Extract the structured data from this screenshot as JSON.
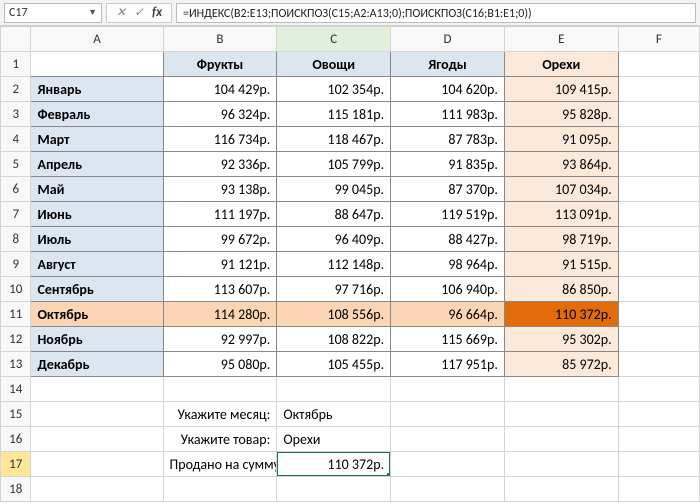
{
  "formula_bar": {
    "cell_ref": "C17",
    "formula": "=ИНДЕКС(B2:E13;ПОИСКПОЗ(C15;A2:A13;0);ПОИСКПОЗ(C16;B1:E1;0))"
  },
  "columns": [
    "A",
    "B",
    "C",
    "D",
    "E",
    "F"
  ],
  "headers": {
    "b": "Фрукты",
    "c": "Овощи",
    "d": "Ягоды",
    "e": "Орехи"
  },
  "months": [
    "Январь",
    "Февраль",
    "Март",
    "Апрель",
    "Май",
    "Июнь",
    "Июль",
    "Август",
    "Сентябрь",
    "Октябрь",
    "Ноябрь",
    "Декабрь"
  ],
  "rows": [
    {
      "b": "104 429р.",
      "c": "102 354р.",
      "d": "104 620р.",
      "e": "109 415р."
    },
    {
      "b": "96 324р.",
      "c": "115 181р.",
      "d": "111 983р.",
      "e": "95 828р."
    },
    {
      "b": "116 734р.",
      "c": "118 467р.",
      "d": "87 783р.",
      "e": "91 095р."
    },
    {
      "b": "92 336р.",
      "c": "105 799р.",
      "d": "91 835р.",
      "e": "93 864р."
    },
    {
      "b": "93 138р.",
      "c": "99 045р.",
      "d": "87 370р.",
      "e": "107 034р."
    },
    {
      "b": "111 197р.",
      "c": "88 647р.",
      "d": "119 519р.",
      "e": "113 091р."
    },
    {
      "b": "99 672р.",
      "c": "96 409р.",
      "d": "88 427р.",
      "e": "98 719р."
    },
    {
      "b": "91 121р.",
      "c": "112 148р.",
      "d": "98 964р.",
      "e": "91 515р."
    },
    {
      "b": "113 607р.",
      "c": "97 716р.",
      "d": "106 940р.",
      "e": "86 850р."
    },
    {
      "b": "114 280р.",
      "c": "108 556р.",
      "d": "96 664р.",
      "e": "110 372р."
    },
    {
      "b": "92 997р.",
      "c": "108 822р.",
      "d": "115 669р.",
      "e": "95 302р."
    },
    {
      "b": "95 080р.",
      "c": "105 455р.",
      "d": "117 951р.",
      "e": "85 972р."
    }
  ],
  "inputs": {
    "month_label": "Укажите месяц:",
    "month_value": "Октябрь",
    "product_label": "Укажите товар:",
    "product_value": "Орехи",
    "sum_label": "Продано на сумму:",
    "sum_value": "110 372р."
  },
  "chart_data": {
    "type": "table",
    "title": "",
    "row_labels": [
      "Январь",
      "Февраль",
      "Март",
      "Апрель",
      "Май",
      "Июнь",
      "Июль",
      "Август",
      "Сентябрь",
      "Октябрь",
      "Ноябрь",
      "Декабрь"
    ],
    "columns": [
      "Фрукты",
      "Овощи",
      "Ягоды",
      "Орехи"
    ],
    "values": [
      [
        104429,
        102354,
        104620,
        109415
      ],
      [
        96324,
        115181,
        111983,
        95828
      ],
      [
        116734,
        118467,
        87783,
        91095
      ],
      [
        92336,
        105799,
        91835,
        93864
      ],
      [
        93138,
        99045,
        87370,
        107034
      ],
      [
        111197,
        88647,
        119519,
        113091
      ],
      [
        99672,
        96409,
        88427,
        98719
      ],
      [
        91121,
        112148,
        98964,
        91515
      ],
      [
        113607,
        97716,
        106940,
        86850
      ],
      [
        114280,
        108556,
        96664,
        110372
      ],
      [
        92997,
        108822,
        115669,
        95302
      ],
      [
        95080,
        105455,
        117951,
        85972
      ]
    ],
    "unit": "р.",
    "lookup": {
      "month": "Октябрь",
      "product": "Орехи",
      "result": 110372
    }
  }
}
